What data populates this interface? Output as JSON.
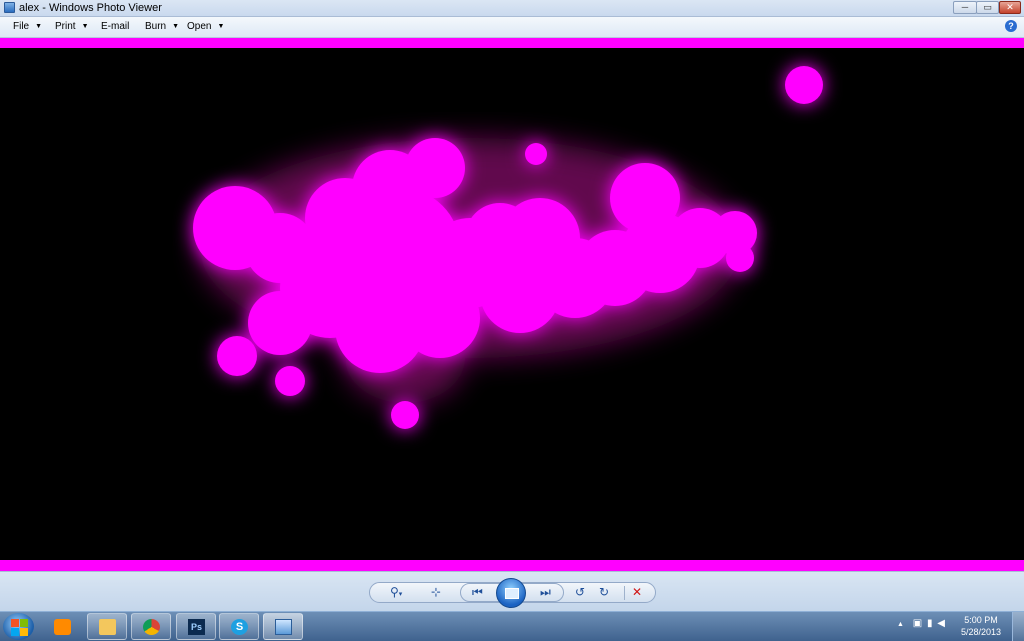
{
  "window": {
    "title": "alex - Windows Photo Viewer",
    "controls": {
      "minimize": "─",
      "maximize": "▭",
      "close": "✕"
    }
  },
  "menu": {
    "items": [
      {
        "label": "File",
        "has_dropdown": true
      },
      {
        "label": "Print",
        "has_dropdown": true
      },
      {
        "label": "E-mail",
        "has_dropdown": false
      },
      {
        "label": "Burn",
        "has_dropdown": true
      },
      {
        "label": "Open",
        "has_dropdown": true
      }
    ],
    "help_label": "?"
  },
  "photo": {
    "background": "#000000",
    "frame_color": "#ff00ff",
    "blob_color": "#ff00ff"
  },
  "controls": {
    "zoom_icon": "magnifier-icon",
    "fit_icon": "actual-size-icon",
    "prev_icon": "previous-icon",
    "slideshow_icon": "slideshow-icon",
    "next_icon": "next-icon",
    "rotate_ccw_icon": "rotate-counterclockwise-icon",
    "rotate_cw_icon": "rotate-clockwise-icon",
    "delete_icon": "delete-icon"
  },
  "taskbar": {
    "apps": [
      {
        "name": "media-player",
        "icon": "media-player-icon",
        "color": "#ff8a00"
      },
      {
        "name": "explorer",
        "icon": "folder-icon",
        "color": "#f3c75d"
      },
      {
        "name": "chrome",
        "icon": "chrome-icon",
        "color": "#3b8beb"
      },
      {
        "name": "photoshop",
        "icon": "photoshop-icon",
        "color": "#0b2a4f",
        "label": "Ps"
      },
      {
        "name": "skype",
        "icon": "skype-icon",
        "color": "#1ea0e1",
        "label": "S"
      },
      {
        "name": "photo-viewer",
        "icon": "photo-viewer-icon",
        "color": "#7fb2e6"
      }
    ],
    "tray": {
      "arrow": "▲"
    },
    "clock": {
      "time": "5:00 PM",
      "date": "5/28/2013"
    }
  }
}
